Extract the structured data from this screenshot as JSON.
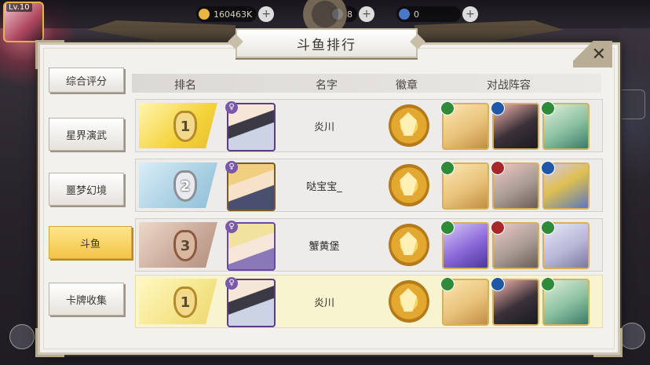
{
  "hud": {
    "level": "Lv.10",
    "resource1": "160463K",
    "resource2": "8",
    "resource3": "0"
  },
  "dialog": {
    "title": "斗鱼排行",
    "close_icon": "close-icon"
  },
  "tabs": [
    {
      "label": "综合评分",
      "active": false
    },
    {
      "label": "星界演武",
      "active": false
    },
    {
      "label": "噩梦幻境",
      "active": false
    },
    {
      "label": "斗鱼",
      "active": true
    },
    {
      "label": "卡牌收集",
      "active": false
    }
  ],
  "columns": {
    "rank": "排名",
    "name": "名字",
    "badge": "徽章",
    "lineup": "对战阵容"
  },
  "rows": [
    {
      "rank": "1",
      "name": "炎川"
    },
    {
      "rank": "2",
      "name": "哒宝宝_"
    },
    {
      "rank": "3",
      "name": "蟹黄堡"
    },
    {
      "rank": "1",
      "name": "炎川"
    }
  ],
  "colors": {
    "gold": "#f4d33a",
    "silver": "#a8cfe2",
    "bronze": "#c8a898",
    "active_tab": "#f3c448"
  }
}
